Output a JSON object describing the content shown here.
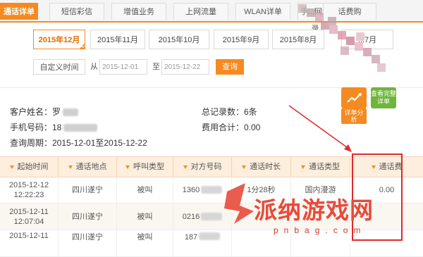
{
  "tabs": [
    {
      "label": "通话详单",
      "active": true
    },
    {
      "label": "短信彩信",
      "active": false
    },
    {
      "label": "增值业务",
      "active": false
    },
    {
      "label": "上网流量",
      "active": false
    },
    {
      "label": "WLAN详单",
      "active": false
    },
    {
      "label": "手...网记录",
      "active": false
    },
    {
      "label": "话费购",
      "active": false
    }
  ],
  "months": [
    {
      "label": "2015年12月",
      "active": true
    },
    {
      "label": "2015年11月",
      "active": false
    },
    {
      "label": "2015年10月",
      "active": false
    },
    {
      "label": "2015年9月",
      "active": false
    },
    {
      "label": "2015年8月",
      "active": false
    },
    {
      "label": "...7月",
      "active": false
    }
  ],
  "filter": {
    "custom_label": "自定义时间",
    "from_label": "从",
    "from_value": "2015-12-01",
    "to_label": "至",
    "to_value": "2015-12-22",
    "query_label": "查询"
  },
  "actions": {
    "analysis_label": "详单分析",
    "full_label": "查看完整详单"
  },
  "info": {
    "customer_label": "客户姓名：罗",
    "phone_label": "手机号码：18",
    "period_label": "查询周期：2015-12-01至2015-12-22",
    "total_records": "总记录数：6条",
    "total_fee": "费用合计：0.00"
  },
  "table": {
    "headers": [
      "起始时间",
      "通话地点",
      "呼叫类型",
      "对方号码",
      "通话时长",
      "通话类型",
      "通话费"
    ],
    "rows": [
      [
        "2015-12-12 12:22:23",
        "四川遂宁",
        "被叫",
        "1360",
        "1分28秒",
        "国内漫游",
        "0.00"
      ],
      [
        "2015-12-11 12:07:04",
        "四川遂宁",
        "被叫",
        "0216",
        "",
        "",
        ""
      ],
      [
        "2015-12-11",
        "四川遂宁",
        "被叫",
        "187",
        "",
        "",
        ""
      ]
    ]
  },
  "watermark": {
    "text": "派纳游戏网",
    "url": "pnbag.com"
  },
  "colors": {
    "accent": "#f58a20",
    "green": "#6fb53a",
    "annotation": "#e0282e"
  }
}
